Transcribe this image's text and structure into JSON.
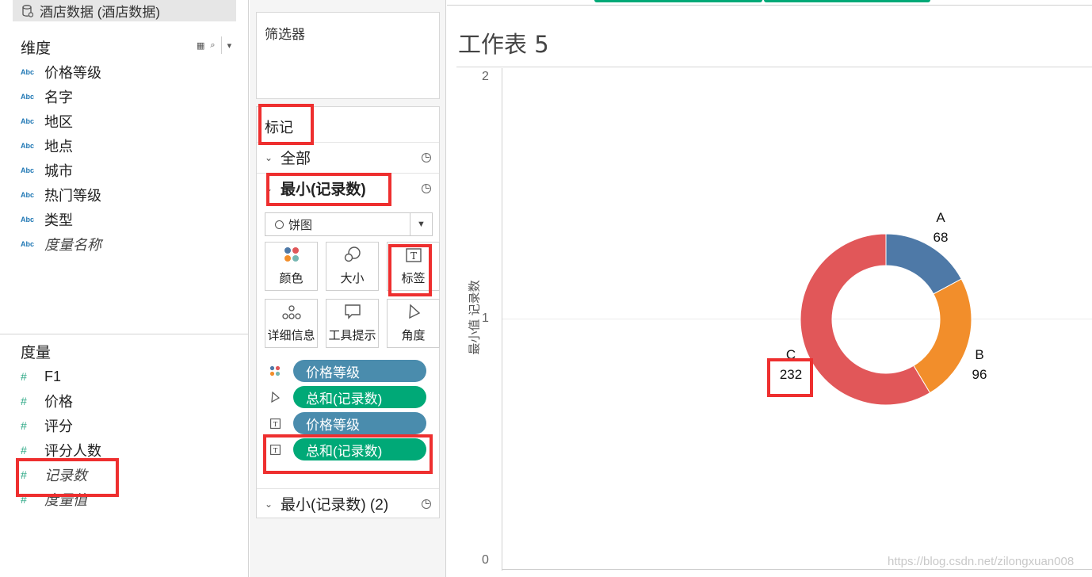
{
  "datasource": {
    "label": "酒店数据 (酒店数据)"
  },
  "dimensions": {
    "title": "维度",
    "tool_grid": "▦",
    "tool_search": "⌕",
    "tool_menu": "▾",
    "abc_tag": "Abc",
    "items": [
      "价格等级",
      "名字",
      "地区",
      "地点",
      "城市",
      "热门等级",
      "类型",
      "度量名称"
    ]
  },
  "measures": {
    "title": "度量",
    "hash_tag": "#",
    "items": [
      "F1",
      "价格",
      "评分",
      "评分人数",
      "记录数",
      "度量值"
    ]
  },
  "filters": {
    "title": "筛选器"
  },
  "marks": {
    "title": "标记",
    "rows": [
      "全部",
      "最小(记录数)",
      "最小(记录数) (2)"
    ],
    "mark_type": "饼图",
    "buttons": [
      "颜色",
      "大小",
      "标签",
      "详细信息",
      "工具提示",
      "角度"
    ],
    "shelf": [
      {
        "label": "价格等级",
        "kind": "color"
      },
      {
        "label": "总和(记录数)",
        "kind": "angle"
      },
      {
        "label": "价格等级",
        "kind": "label"
      },
      {
        "label": "总和(记录数)",
        "kind": "label"
      }
    ],
    "colors": {
      "dimension_pill": "#4a8cad",
      "measure_pill": "#00a977"
    }
  },
  "worksheet": {
    "title": "工作表 5",
    "axis_title": "最小值 记录数",
    "watermark": "https://blog.csdn.net/zilongxuan008"
  },
  "chart_data": {
    "type": "pie",
    "style": "donut",
    "categories": [
      "A",
      "B",
      "C"
    ],
    "values": [
      68,
      96,
      232
    ],
    "colors": [
      "#4e79a7",
      "#f28e2b",
      "#e15759"
    ],
    "y_ticks": [
      2,
      1,
      0
    ],
    "ylabel": "最小值 记录数",
    "ylim": [
      0,
      2
    ],
    "grid": true
  }
}
